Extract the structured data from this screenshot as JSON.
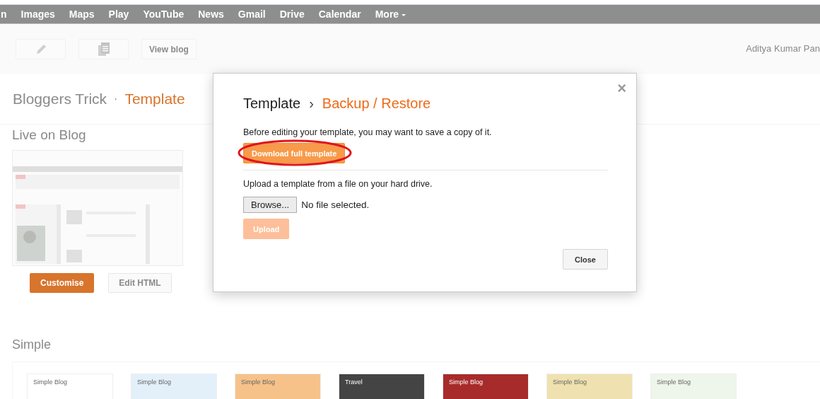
{
  "nav_bar": {
    "items": [
      "n",
      "Images",
      "Maps",
      "Play",
      "YouTube",
      "News",
      "Gmail",
      "Drive",
      "Calendar",
      "More"
    ],
    "last_has_menu": true
  },
  "toolbar": {
    "buttons": [
      {
        "kind": "pencil"
      },
      {
        "kind": "pages"
      },
      {
        "kind": "text",
        "label": "View blog"
      }
    ],
    "user_name": "Aditya Kumar Pan"
  },
  "page_title": {
    "blog": "Bloggers Trick",
    "separator": "·",
    "section": "Template"
  },
  "live": {
    "heading": "Live on Blog",
    "buttons": [
      {
        "label": "Customise",
        "primary": true
      },
      {
        "label": "Edit HTML",
        "primary": false
      }
    ]
  },
  "gallery": {
    "heading": "Simple",
    "thumbnails": [
      {
        "title": "Simple Blog",
        "color": "#ffffff"
      },
      {
        "title": "Simple Blog",
        "color": "#e3f0fa"
      },
      {
        "title": "Simple Blog",
        "color": "#f6c28a"
      },
      {
        "title": "Travel",
        "color": "#444444"
      },
      {
        "title": "Simple Blog",
        "color": "#a82b2b"
      },
      {
        "title": "Simple Blog",
        "color": "#efe2b0"
      },
      {
        "title": "Simple Blog",
        "color": "#eef5ea"
      }
    ]
  },
  "dialog": {
    "title": "Template",
    "separator": "›",
    "subtitle": "Backup / Restore",
    "close_icon": "×",
    "backup_text": "Before editing your template, you may want to save a copy of it.",
    "download_button": {
      "label": "Download full template",
      "highlighted": true
    },
    "upload_text": "Upload a template from a file on your hard drive.",
    "browse_button": "Browse...",
    "file_status": "No file selected.",
    "upload_button": {
      "label": "Upload",
      "disabled": true
    },
    "close_button": "Close"
  }
}
